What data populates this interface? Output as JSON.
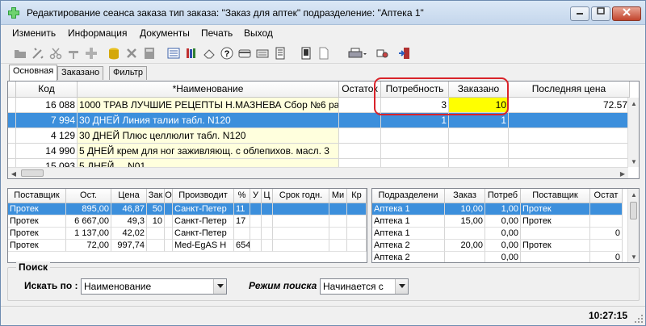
{
  "window": {
    "title": "Редактирование сеанса заказа тип заказа: \"Заказ для аптек\" подразделение: \"Аптека 1\""
  },
  "menu": [
    "Изменить",
    "Информация",
    "Документы",
    "Печать",
    "Выход"
  ],
  "toolbar_icons": [
    "open-folder-icon",
    "tools-icon",
    "scissors-icon",
    "hammer-icon",
    "plus-cross-icon",
    "database-icon",
    "delete-icon",
    "calculator-icon",
    "list-icon",
    "books-icon",
    "eraser-icon",
    "help-icon",
    "card-icon",
    "keyboard-icon",
    "notebook-icon",
    "page-icon",
    "blank-page-icon",
    "printer-icon",
    "pills-icon",
    "exit-door-icon"
  ],
  "tabs": [
    "Основная",
    "Заказано",
    "Фильтр"
  ],
  "main_grid": {
    "columns": [
      "Код",
      "*Наименование",
      "Остаток",
      "Потребность",
      "Заказано",
      "Последняя цена"
    ],
    "rows": [
      {
        "code": "16 088",
        "name": "1000 ТРАВ ЛУЧШИЕ РЕЦЕПТЫ Н.МАЗНЕВА Сбор №6 рас",
        "stock": "",
        "need": "3",
        "ordered": "10",
        "last_price": "72.57"
      },
      {
        "code": "7 994",
        "name": "30 ДНЕЙ Линия талии табл. N120",
        "stock": "",
        "need": "1",
        "ordered": "1",
        "last_price": ""
      },
      {
        "code": "4 129",
        "name": "30 ДНЕЙ Плюс целлюлит табл. N120",
        "stock": "",
        "need": "",
        "ordered": "",
        "last_price": ""
      },
      {
        "code": "14 990",
        "name": "5 ДНЕЙ крем для ног заживляющ. с облепихов. масл. 3",
        "stock": "",
        "need": "",
        "ordered": "",
        "last_price": ""
      },
      {
        "code": "15 093",
        "name": "5 ДНЕЙ ... N01",
        "stock": "",
        "need": "",
        "ordered": "",
        "last_price": ""
      }
    ],
    "ordered_highlight_color": "#ffff00",
    "name_column_color": "#ffffdd",
    "selected_color": "#3c8fdc"
  },
  "suppliers_grid": {
    "columns": [
      "Поставщик",
      "Ост.",
      "Цена",
      "Зак",
      "О",
      "Производит",
      "%",
      "У",
      "Ц",
      "Срок годн.",
      "Ми",
      "Кр"
    ],
    "rows": [
      [
        "Протек",
        "895,00",
        "46,87",
        "50",
        "",
        "Санкт-Петер",
        "11",
        "",
        "",
        "",
        "",
        ""
      ],
      [
        "Протек",
        "6 667,00",
        "49,3",
        "10",
        "",
        "Санкт-Петер",
        "17",
        "",
        "",
        "",
        "",
        ""
      ],
      [
        "Протек",
        "1 137,00",
        "42,02",
        "",
        "",
        "Санкт-Петер",
        "",
        "",
        "",
        "",
        "",
        ""
      ],
      [
        "Протек",
        "72,00",
        "997,74",
        "",
        "",
        "Med-EgAS H",
        "654",
        "",
        "",
        "",
        "",
        ""
      ]
    ]
  },
  "departments_grid": {
    "columns": [
      "Подразделени",
      "Заказ",
      "Потреб",
      "Поставщик",
      "Остат"
    ],
    "rows": [
      [
        "Аптека 1",
        "10,00",
        "1,00",
        "Протек",
        ""
      ],
      [
        "Аптека 1",
        "15,00",
        "0,00",
        "Протек",
        ""
      ],
      [
        "Аптека 1",
        "",
        "0,00",
        "",
        "0"
      ],
      [
        "Аптека 2",
        "20,00",
        "0,00",
        "Протек",
        ""
      ],
      [
        "Аптека 2",
        "",
        "0,00",
        "",
        "0"
      ]
    ]
  },
  "search": {
    "legend": "Поиск",
    "search_by_label": "Искать по :",
    "search_by_value": "Наименование",
    "mode_label": "Режим поиска",
    "mode_value": "Начинается с"
  },
  "status": {
    "time": "10:27:15"
  }
}
